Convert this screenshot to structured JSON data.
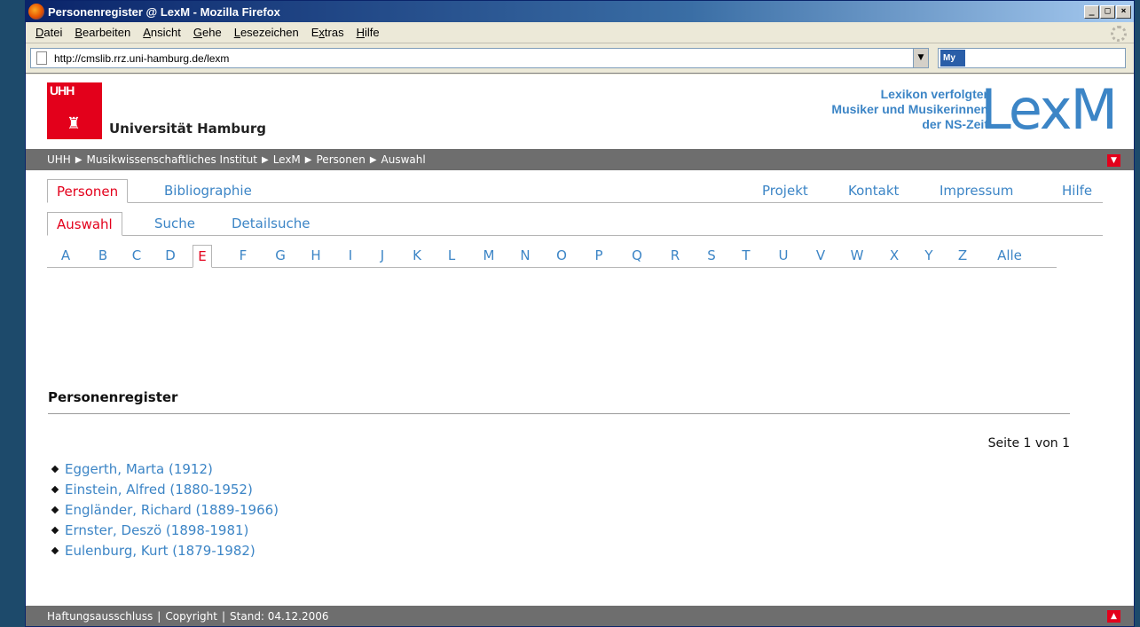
{
  "window": {
    "title": "Personenregister @ LexM - Mozilla Firefox",
    "minimize": "_",
    "maximize": "□",
    "close": "×"
  },
  "menu": [
    {
      "mnemonic": "D",
      "rest": "atei"
    },
    {
      "mnemonic": "B",
      "rest": "earbeiten"
    },
    {
      "mnemonic": "A",
      "rest": "nsicht"
    },
    {
      "mnemonic": "G",
      "rest": "ehe"
    },
    {
      "mnemonic": "L",
      "rest": "esezeichen"
    },
    {
      "pre": "E",
      "mnemonic": "x",
      "rest": "tras"
    },
    {
      "mnemonic": "H",
      "rest": "ilfe"
    }
  ],
  "address": {
    "url": "http://cmslib.rrz.uni-hamburg.de/lexm",
    "search_engine": "My"
  },
  "header": {
    "logo_text": "UHH",
    "university": "Universität Hamburg",
    "subtitle_lines": [
      "Lexikon verfolgter",
      "Musiker und Musikerinnen",
      "der NS-Zeit"
    ],
    "brand": "LexM"
  },
  "breadcrumb": [
    "UHH",
    "Musikwissenschaftliches Institut",
    "LexM",
    "Personen",
    "Auswahl"
  ],
  "tabs_main": {
    "left": [
      {
        "label": "Personen",
        "active": true
      },
      {
        "label": "Bibliographie",
        "active": false
      }
    ],
    "right": [
      "Projekt",
      "Kontakt",
      "Impressum",
      "Hilfe"
    ]
  },
  "tabs_sub": [
    {
      "label": "Auswahl",
      "active": true
    },
    {
      "label": "Suche",
      "active": false
    },
    {
      "label": "Detailsuche",
      "active": false
    }
  ],
  "letters": [
    "A",
    "B",
    "C",
    "D",
    "E",
    "F",
    "G",
    "H",
    "I",
    "J",
    "K",
    "L",
    "M",
    "N",
    "O",
    "P",
    "Q",
    "R",
    "S",
    "T",
    "U",
    "V",
    "W",
    "X",
    "Y",
    "Z",
    "Alle"
  ],
  "active_letter": "E",
  "register": {
    "title": "Personenregister",
    "page_info": "Seite 1 von 1",
    "persons": [
      "Eggerth, Marta (1912)",
      "Einstein, Alfred (1880-1952)",
      "Engländer, Richard (1889-1966)",
      "Ernster, Deszö (1898-1981)",
      "Eulenburg, Kurt (1879-1982)"
    ]
  },
  "footer": {
    "disclaimer": "Haftungsausschluss",
    "copyright": "Copyright",
    "stand": "Stand: 04.12.2006"
  },
  "colors": {
    "link": "#3c85c6",
    "active": "#e3001b",
    "bar": "#6e6e6e"
  },
  "icons": {
    "crumb_separator": "▶",
    "bullet": "diamond"
  }
}
